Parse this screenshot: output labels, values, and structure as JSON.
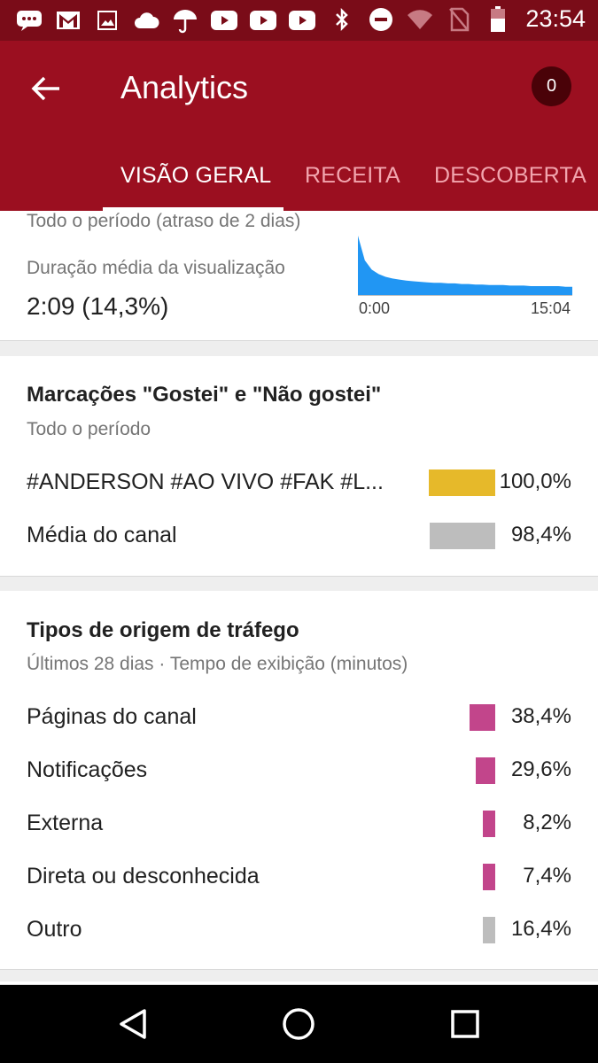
{
  "status_bar": {
    "time": "23:54",
    "icons_left": [
      "chat-icon",
      "gmail-icon",
      "image-icon",
      "cloud-icon",
      "umbrella-icon",
      "youtube-icon",
      "youtube-icon",
      "youtube-icon"
    ],
    "icons_right": [
      "bluetooth-icon",
      "do-not-disturb-icon",
      "wifi-icon",
      "no-sim-icon",
      "battery-icon"
    ]
  },
  "app_bar": {
    "title": "Analytics",
    "notification_count": "0",
    "tabs": [
      {
        "label": "VISÃO GERAL",
        "active": true
      },
      {
        "label": "RECEITA",
        "active": false
      },
      {
        "label": "DESCOBERTA",
        "active": false
      }
    ]
  },
  "retention_card": {
    "period": "Todo o período (atraso de 2 dias)",
    "metric_label": "Duração média da visualização",
    "metric_value": "2:09 (14,3%)",
    "sparkline": {
      "x_start_label": "0:00",
      "x_end_label": "15:04",
      "color": "#2196f3",
      "values": [
        100,
        55,
        38,
        30,
        25,
        22,
        20,
        18,
        17,
        16,
        15,
        14,
        14,
        13,
        13,
        12,
        12,
        11,
        11,
        10,
        10,
        10,
        9,
        9,
        9,
        8,
        8,
        8,
        8,
        8,
        7,
        7
      ]
    }
  },
  "likes_card": {
    "title": "Marcações \"Gostei\" e \"Não gostei\"",
    "subtitle": "Todo o período",
    "rows": [
      {
        "label": "#ANDERSON #AO VIVO #FAK #L...",
        "value": "100,0%",
        "fraction": 1.0,
        "color": "#e6b92a"
      },
      {
        "label": "Média do canal",
        "value": "98,4%",
        "fraction": 0.984,
        "color": "#bdbdbd"
      }
    ]
  },
  "traffic_card": {
    "title": "Tipos de origem de tráfego",
    "subtitle": "Últimos 28 dias · Tempo de exibição (minutos)",
    "rows": [
      {
        "label": "Páginas do canal",
        "value": "38,4%",
        "fraction": 0.384,
        "color": "#c2458b"
      },
      {
        "label": "Notificações",
        "value": "29,6%",
        "fraction": 0.296,
        "color": "#c2458b"
      },
      {
        "label": "Externa",
        "value": "8,2%",
        "fraction": 0.082,
        "color": "#c2458b"
      },
      {
        "label": "Direta ou desconhecida",
        "value": "7,4%",
        "fraction": 0.074,
        "color": "#c2458b"
      },
      {
        "label": "Outro",
        "value": "16,4%",
        "fraction": 0.164,
        "color": "#bdbdbd"
      }
    ]
  },
  "nav_bar": {
    "buttons": [
      "back-nav-icon",
      "home-nav-icon",
      "recents-nav-icon"
    ]
  }
}
